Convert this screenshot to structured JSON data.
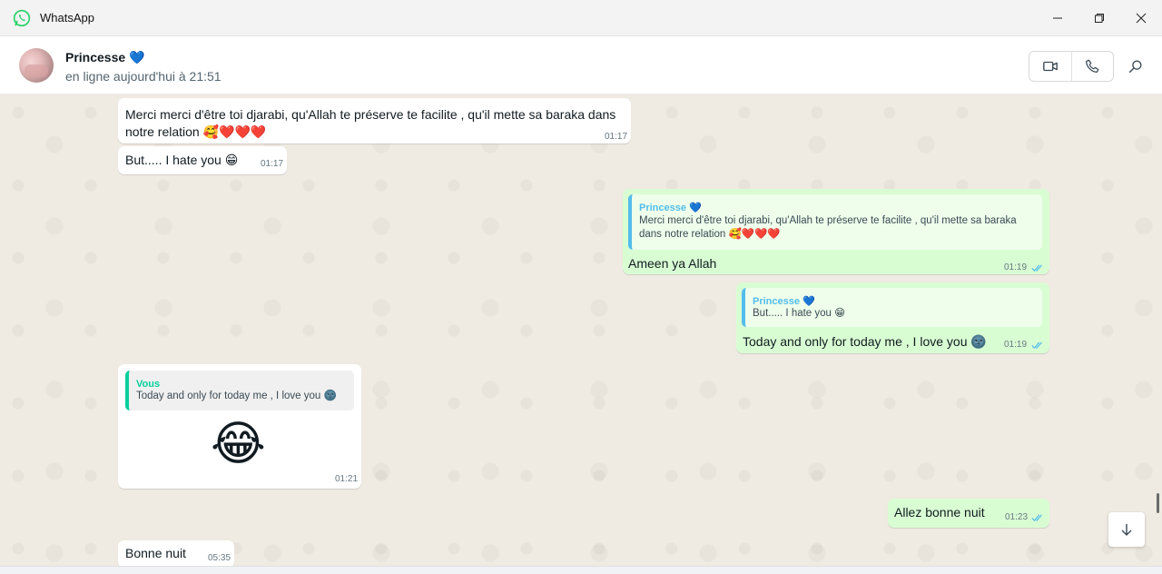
{
  "app": {
    "title": "WhatsApp"
  },
  "header": {
    "contact_name": "Princesse 💙",
    "status": "en ligne aujourd'hui à 21:51"
  },
  "messages": [
    {
      "dir": "in",
      "text": "Merci merci d'être toi djarabi, qu'Allah te préserve te facilite , qu'il mette sa baraka dans notre relation 🥰❤️❤️❤️",
      "time": "01:17"
    },
    {
      "dir": "in",
      "text": "But.....  I hate you 😁",
      "time": "01:17"
    },
    {
      "dir": "out",
      "quote_author": "Princesse 💙",
      "quote_text": "Merci merci d'être toi djarabi, qu'Allah te préserve te facilite , qu'il mette sa baraka dans notre relation 🥰❤️❤️❤️",
      "text": "Ameen ya Allah",
      "time": "01:19",
      "status": "read"
    },
    {
      "dir": "out",
      "quote_author": "Princesse 💙",
      "quote_text": "But.....  I hate you 😁",
      "text": "Today and only for today me , I love you 🌚",
      "time": "01:19",
      "status": "read"
    },
    {
      "dir": "in",
      "quote_author": "Vous",
      "quote_text": "Today and only for today me , I love you 🌚",
      "text": "😂",
      "time": "01:21"
    },
    {
      "dir": "out",
      "text": "Allez bonne nuit",
      "time": "01:23",
      "status": "read"
    },
    {
      "dir": "in",
      "text": "Bonne nuit",
      "time": "05:35"
    }
  ],
  "icons": {
    "logo": "whatsapp-logo",
    "video": "video-call-icon",
    "voice": "voice-call-icon",
    "search": "search-icon",
    "scroll": "arrow-down-icon",
    "read": "double-check-icon"
  },
  "colors": {
    "incoming_bubble": "#ffffff",
    "outgoing_bubble": "#d9fdd3",
    "wallpaper": "#efeae2",
    "read_ticks": "#53bdeb",
    "brand": "#25d366"
  }
}
